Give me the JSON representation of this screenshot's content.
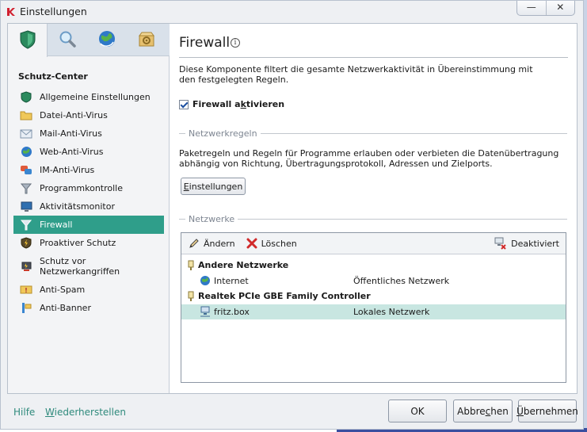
{
  "window": {
    "title": "Einstellungen",
    "minimize_label": "—",
    "close_label": "✕"
  },
  "sidebar": {
    "tabs": [
      "protection-tab",
      "scan-tab",
      "update-tab",
      "settings-tab"
    ],
    "heading": "Schutz-Center",
    "items": [
      {
        "label": "Allgemeine Einstellungen",
        "icon": "shield-icon"
      },
      {
        "label": "Datei-Anti-Virus",
        "icon": "folder-icon"
      },
      {
        "label": "Mail-Anti-Virus",
        "icon": "mail-icon"
      },
      {
        "label": "Web-Anti-Virus",
        "icon": "globe-icon"
      },
      {
        "label": "IM-Anti-Virus",
        "icon": "chat-icon"
      },
      {
        "label": "Programmkontrolle",
        "icon": "filter-icon"
      },
      {
        "label": "Aktivitätsmonitor",
        "icon": "monitor-icon"
      },
      {
        "label": "Firewall",
        "icon": "firewall-icon",
        "active": true
      },
      {
        "label": "Proaktiver Schutz",
        "icon": "lightning-shield-icon"
      },
      {
        "label": "Schutz vor Netzwerkangriffen",
        "icon": "network-attack-icon"
      },
      {
        "label": "Anti-Spam",
        "icon": "spam-icon"
      },
      {
        "label": "Anti-Banner",
        "icon": "banner-icon"
      }
    ]
  },
  "main": {
    "title": "Firewall",
    "info_symbol": "i",
    "description": "Diese Komponente filtert die gesamte Netzwerkaktivität in Übereinstimmung mit den festgelegten Regeln.",
    "enable_checkbox": {
      "pre": "Firewall a",
      "accel": "k",
      "post": "tivieren",
      "checked": true
    },
    "rules_group": "Netzwerkregeln",
    "rules_description": "Paketregeln und Regeln für Programme erlauben oder verbieten die Datenübertragung abhängig von Richtung, Übertragungsprotokoll, Adressen und Zielports.",
    "settings_button": {
      "accel": "E",
      "rest": "instellungen"
    },
    "networks_group": "Netzwerke",
    "toolbar": {
      "edit": "Ändern",
      "delete": "Löschen",
      "deactivated": "Deaktiviert"
    },
    "networks": [
      {
        "type": "group",
        "name": "Andere Netzwerke"
      },
      {
        "type": "item",
        "name": "Internet",
        "kind": "Öffentliches Netzwerk",
        "icon": "globe-icon"
      },
      {
        "type": "group",
        "name": "Realtek PCIe GBE Family Controller"
      },
      {
        "type": "item",
        "name": "fritz.box",
        "kind": "Lokales Netzwerk",
        "icon": "lan-icon",
        "selected": true
      }
    ]
  },
  "footer": {
    "help": "Hilfe",
    "restore": {
      "accel": "W",
      "rest": "iederherstellen"
    },
    "ok": "OK",
    "cancel": {
      "pre": "Abbre",
      "accel": "c",
      "post": "hen"
    },
    "apply": {
      "accel": "Ü",
      "rest": "bernehmen"
    }
  },
  "colors": {
    "accent": "#2f9e8a",
    "link": "#2f8a7c",
    "selection": "#c8e6e1"
  }
}
